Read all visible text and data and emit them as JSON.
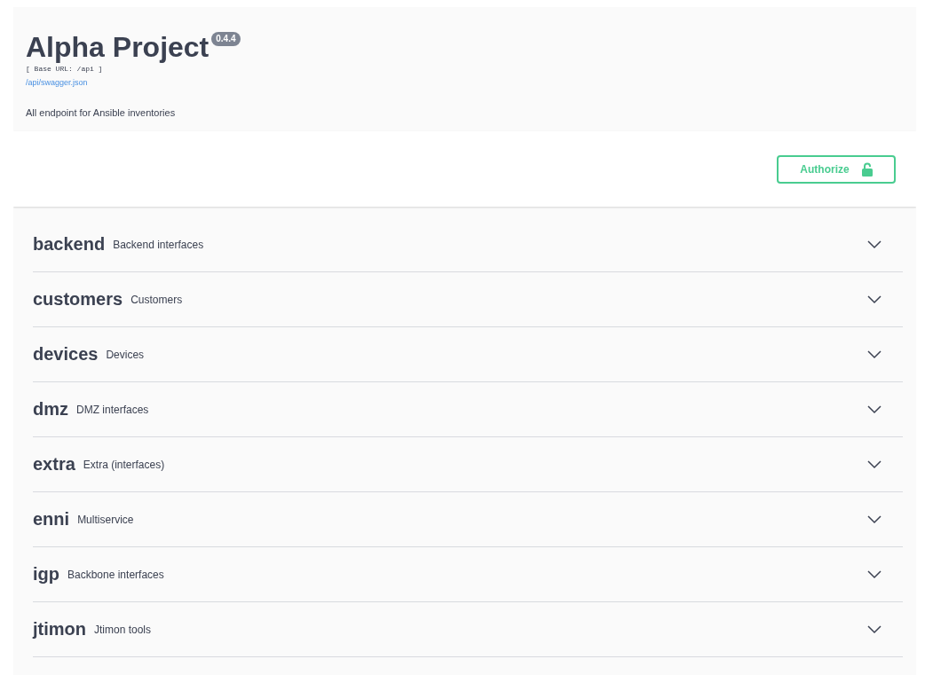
{
  "info": {
    "title": "Alpha Project",
    "version": "0.4.4",
    "base_url": "[ Base URL: /api ]",
    "spec_link": "/api/swagger.json",
    "description": "All endpoint for Ansible inventories"
  },
  "auth": {
    "label": "Authorize",
    "locked": false
  },
  "tags": [
    {
      "name": "backend",
      "description": "Backend interfaces",
      "expanded": false
    },
    {
      "name": "customers",
      "description": "Customers",
      "expanded": false
    },
    {
      "name": "devices",
      "description": "Devices",
      "expanded": false
    },
    {
      "name": "dmz",
      "description": "DMZ interfaces",
      "expanded": false
    },
    {
      "name": "extra",
      "description": "Extra (interfaces)",
      "expanded": false
    },
    {
      "name": "enni",
      "description": "Multiservice",
      "expanded": false
    },
    {
      "name": "igp",
      "description": "Backbone interfaces",
      "expanded": false
    },
    {
      "name": "jtimon",
      "description": "Jtimon tools",
      "expanded": false
    }
  ]
}
